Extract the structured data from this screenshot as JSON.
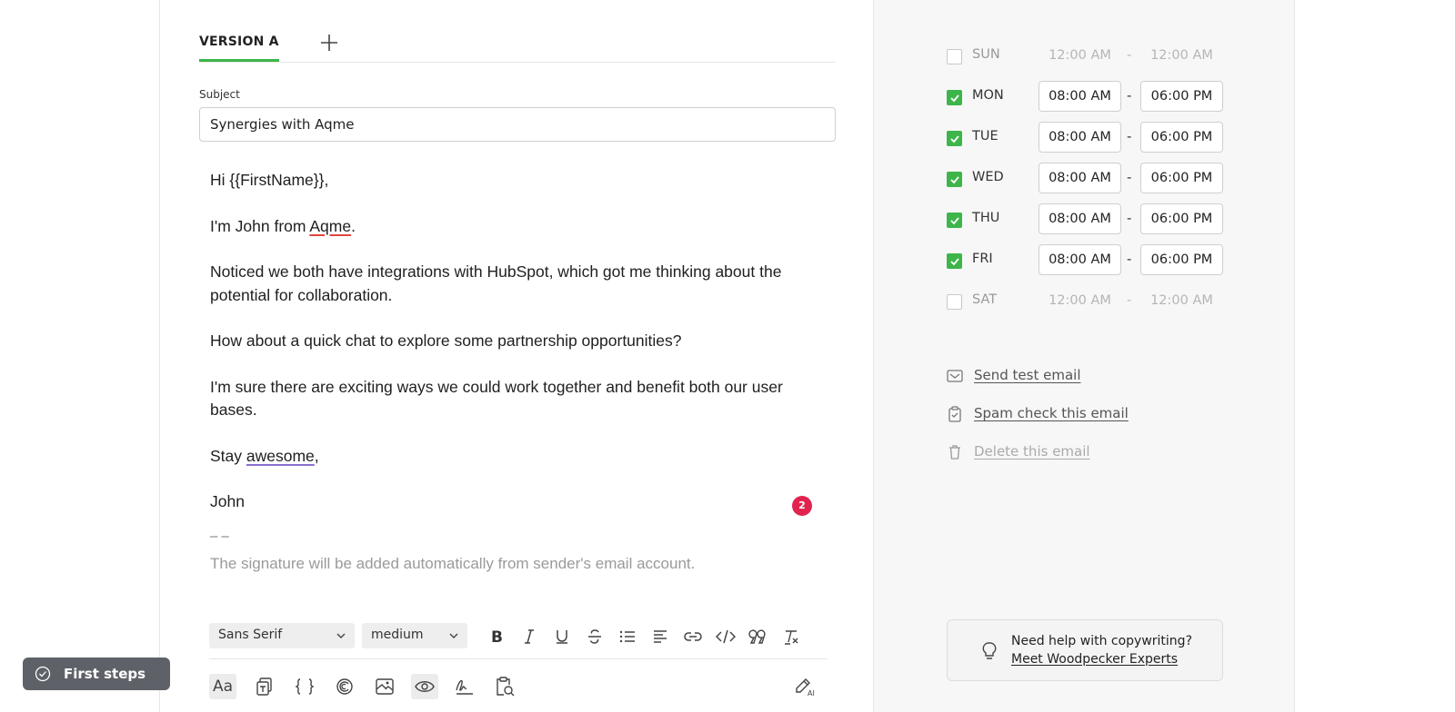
{
  "tabs": {
    "active_label": "VERSION A"
  },
  "subject": {
    "label": "Subject",
    "value": "Synergies with Aqme"
  },
  "email_body": {
    "greeting": "Hi {{FirstName}},",
    "intro_prefix": "I'm John from ",
    "intro_company": "Aqme",
    "intro_suffix": ".",
    "paragraph_1_line_1": "Noticed we both have integrations with HubSpot, which got me thinking about the",
    "paragraph_1_line_2": "potential for collaboration.",
    "paragraph_2": "How about a quick chat to explore some partnership opportunities?",
    "paragraph_3_line_1": "I'm sure there are exciting ways we could work together and benefit both our user",
    "paragraph_3_line_2": "bases.",
    "signoff_prefix": "Stay ",
    "signoff_word": "awesome",
    "signoff_suffix": ",",
    "name": "John",
    "signature_separator": "– –",
    "signature_note": "The signature will be added automatically from sender's email account."
  },
  "issues_badge": "2",
  "toolbar": {
    "font_family": "Sans Serif",
    "font_size": "medium",
    "format_icons": [
      "bold-icon",
      "italic-icon",
      "underline-icon",
      "strikethrough-icon",
      "bullet-list-icon",
      "align-icon",
      "link-icon",
      "code-icon",
      "quote-icon",
      "clear-format-icon"
    ],
    "insert_icons": [
      "text-format-icon",
      "template-icon",
      "variables-icon",
      "spintax-icon",
      "image-icon",
      "preview-icon",
      "signature-icon",
      "spam-check-icon",
      "ai-writer-icon"
    ]
  },
  "schedule": [
    {
      "day": "SUN",
      "enabled": false,
      "from": "12:00 AM",
      "to": "12:00 AM"
    },
    {
      "day": "MON",
      "enabled": true,
      "from": "08:00 AM",
      "to": "06:00 PM"
    },
    {
      "day": "TUE",
      "enabled": true,
      "from": "08:00 AM",
      "to": "06:00 PM"
    },
    {
      "day": "WED",
      "enabled": true,
      "from": "08:00 AM",
      "to": "06:00 PM"
    },
    {
      "day": "THU",
      "enabled": true,
      "from": "08:00 AM",
      "to": "06:00 PM"
    },
    {
      "day": "FRI",
      "enabled": true,
      "from": "08:00 AM",
      "to": "06:00 PM"
    },
    {
      "day": "SAT",
      "enabled": false,
      "from": "12:00 AM",
      "to": "12:00 AM"
    }
  ],
  "time_separator": "-",
  "actions": {
    "send_test": "Send test email",
    "spam_check": "Spam check this email",
    "delete": "Delete this email"
  },
  "help": {
    "line1": "Need help with copywriting?",
    "link": "Meet Woodpecker Experts"
  },
  "first_steps": {
    "label": "First steps"
  },
  "colors": {
    "accent_green": "#3db54a",
    "badge_red": "#e0244f",
    "spell_red": "#e0443f",
    "grammar_purple": "#8a6fd1"
  }
}
